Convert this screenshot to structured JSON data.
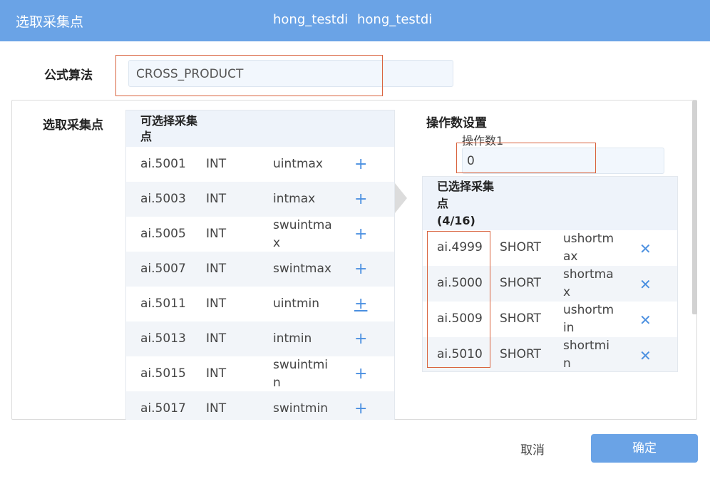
{
  "header": {
    "title": "选取采集点",
    "subtitles": [
      "hong_testdi",
      "hong_testdi"
    ]
  },
  "formula": {
    "label": "公式算法",
    "value": "CROSS_PRODUCT"
  },
  "select_section": {
    "label": "选取采集点"
  },
  "available": {
    "header": "可选择采集点",
    "add_icon": "plus-icon",
    "rows": [
      {
        "id": "ai.5001",
        "type": "INT",
        "name": "uintmax"
      },
      {
        "id": "ai.5003",
        "type": "INT",
        "name": "intmax"
      },
      {
        "id": "ai.5005",
        "type": "INT",
        "name": "swuintmax"
      },
      {
        "id": "ai.5007",
        "type": "INT",
        "name": "swintmax"
      },
      {
        "id": "ai.5011",
        "type": "INT",
        "name": "uintmin"
      },
      {
        "id": "ai.5013",
        "type": "INT",
        "name": "intmin"
      },
      {
        "id": "ai.5015",
        "type": "INT",
        "name": "swuintmin"
      },
      {
        "id": "ai.5017",
        "type": "INT",
        "name": "swintmin"
      }
    ]
  },
  "operands": {
    "title": "操作数设置",
    "operand1_label": "操作数1",
    "operand1_value": "0"
  },
  "selected": {
    "header": "已选择采集点",
    "count": "(4/16)",
    "remove_icon": "close-icon",
    "rows": [
      {
        "id": "ai.4999",
        "type": "SHORT",
        "name": "ushortmax"
      },
      {
        "id": "ai.5000",
        "type": "SHORT",
        "name": "shortmax"
      },
      {
        "id": "ai.5009",
        "type": "SHORT",
        "name": "ushortmin"
      },
      {
        "id": "ai.5010",
        "type": "SHORT",
        "name": "shortmin"
      }
    ]
  },
  "footer": {
    "cancel_label": "取消",
    "confirm_label": "确定"
  },
  "colors": {
    "header_bg": "#6aa3e6",
    "accent": "#4a8fe0",
    "highlight_border": "#d9633e",
    "table_header_bg": "#eef3fa",
    "row_alt_bg": "#f2f5f9"
  }
}
